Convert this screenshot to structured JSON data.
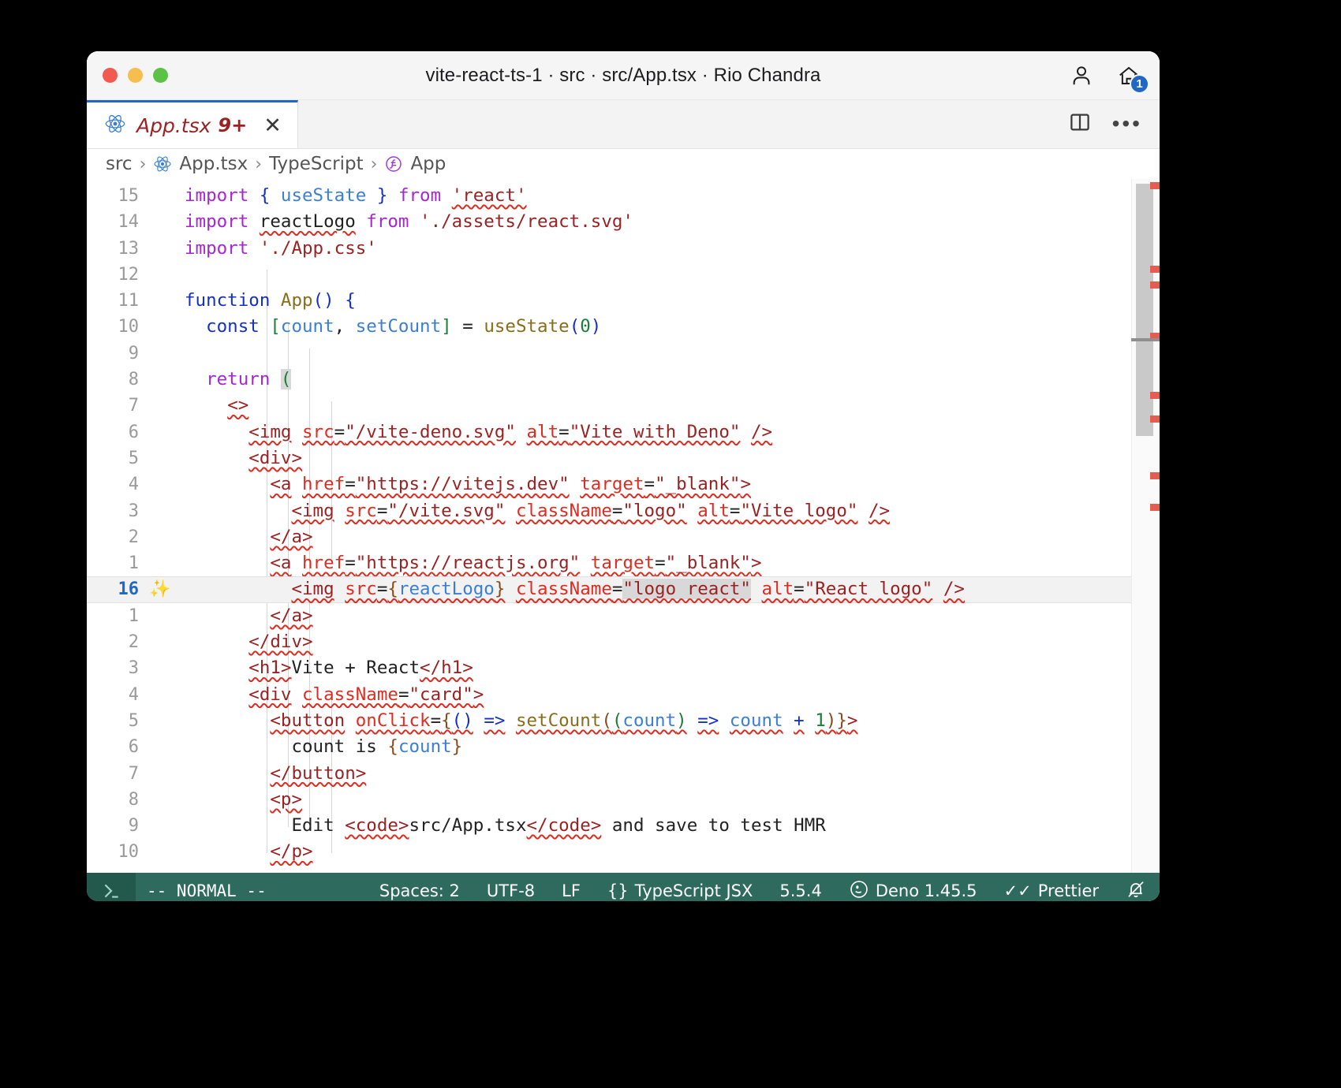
{
  "window": {
    "title": "vite-react-ts-1 · src · src/App.tsx · Rio Chandra",
    "traffic_lights": [
      "close",
      "minimize",
      "zoom"
    ],
    "accent_blue": "#2167c4",
    "home_badge": "1"
  },
  "titlebar_icons": [
    {
      "name": "account-icon",
      "label": "Account"
    },
    {
      "name": "home-icon",
      "label": "Home"
    }
  ],
  "tab": {
    "icon": "react-icon",
    "label": "App.tsx",
    "badge": "9+",
    "close": "✕"
  },
  "tabbar_actions": [
    {
      "name": "split-editor-icon",
      "label": "Split Editor Right"
    },
    {
      "name": "more-actions-icon",
      "label": "•••"
    }
  ],
  "breadcrumb": {
    "items": [
      {
        "label": "src",
        "icon": null
      },
      {
        "label": "App.tsx",
        "icon": "react-icon"
      },
      {
        "label": "TypeScript",
        "icon": null
      },
      {
        "label": "App",
        "icon": "function-symbol-icon"
      }
    ],
    "separator": "›"
  },
  "editor": {
    "current_line": "16",
    "lightbulb": "✨",
    "lines": [
      {
        "num": "15",
        "current": false,
        "tokens": [
          {
            "t": "import",
            "c": "k-import"
          },
          {
            "t": " ",
            "c": "k-plain"
          },
          {
            "t": "{",
            "c": "k-blue"
          },
          {
            "t": " ",
            "c": "k-plain"
          },
          {
            "t": "useState",
            "c": "k-var"
          },
          {
            "t": " ",
            "c": "k-plain"
          },
          {
            "t": "}",
            "c": "k-blue"
          },
          {
            "t": " ",
            "c": "k-plain"
          },
          {
            "t": "from",
            "c": "k-import"
          },
          {
            "t": " ",
            "c": "k-plain"
          },
          {
            "t": "'react'",
            "c": "k-str sq"
          }
        ]
      },
      {
        "num": "14",
        "current": false,
        "tokens": [
          {
            "t": "import",
            "c": "k-import"
          },
          {
            "t": " ",
            "c": "k-plain"
          },
          {
            "t": "reactLogo",
            "c": "k-plain sq"
          },
          {
            "t": " ",
            "c": "k-plain"
          },
          {
            "t": "from",
            "c": "k-import"
          },
          {
            "t": " ",
            "c": "k-plain"
          },
          {
            "t": "'./assets/react.svg'",
            "c": "k-str"
          }
        ]
      },
      {
        "num": "13",
        "current": false,
        "tokens": [
          {
            "t": "import",
            "c": "k-import"
          },
          {
            "t": " ",
            "c": "k-plain"
          },
          {
            "t": "'./App.css'",
            "c": "k-str"
          }
        ]
      },
      {
        "num": "12",
        "current": false,
        "tokens": []
      },
      {
        "num": "11",
        "current": false,
        "tokens": [
          {
            "t": "function",
            "c": "k-blue"
          },
          {
            "t": " ",
            "c": "k-plain"
          },
          {
            "t": "App",
            "c": "k-fn"
          },
          {
            "t": "()",
            "c": "k-blue"
          },
          {
            "t": " ",
            "c": "k-plain"
          },
          {
            "t": "{",
            "c": "k-blue"
          }
        ]
      },
      {
        "num": "10",
        "current": false,
        "tokens": [
          {
            "t": "  ",
            "c": "k-plain"
          },
          {
            "t": "const",
            "c": "k-blue"
          },
          {
            "t": " ",
            "c": "k-plain"
          },
          {
            "t": "[",
            "c": "k-num"
          },
          {
            "t": "count",
            "c": "k-var"
          },
          {
            "t": ", ",
            "c": "k-plain"
          },
          {
            "t": "setCount",
            "c": "k-var"
          },
          {
            "t": "]",
            "c": "k-num"
          },
          {
            "t": " = ",
            "c": "k-plain"
          },
          {
            "t": "useState",
            "c": "k-fn"
          },
          {
            "t": "(",
            "c": "k-blue"
          },
          {
            "t": "0",
            "c": "k-num"
          },
          {
            "t": ")",
            "c": "k-blue"
          }
        ]
      },
      {
        "num": "9",
        "current": false,
        "tokens": []
      },
      {
        "num": "8",
        "current": false,
        "tokens": [
          {
            "t": "  ",
            "c": "k-plain"
          },
          {
            "t": "return",
            "c": "k-import"
          },
          {
            "t": " ",
            "c": "k-plain"
          },
          {
            "t": "(",
            "c": "k-num sel"
          }
        ]
      },
      {
        "num": "7",
        "current": false,
        "tokens": [
          {
            "t": "    ",
            "c": "k-plain"
          },
          {
            "t": "<>",
            "c": "k-tag sq"
          }
        ]
      },
      {
        "num": "6",
        "current": false,
        "tokens": [
          {
            "t": "      ",
            "c": "k-plain"
          },
          {
            "t": "<img",
            "c": "k-tag sq"
          },
          {
            "t": " ",
            "c": "k-plain"
          },
          {
            "t": "src",
            "c": "k-attr sq"
          },
          {
            "t": "=",
            "c": "k-plain sq"
          },
          {
            "t": "\"/vite-deno.svg\"",
            "c": "k-str sq"
          },
          {
            "t": " ",
            "c": "k-plain"
          },
          {
            "t": "alt",
            "c": "k-attr sq"
          },
          {
            "t": "=",
            "c": "k-plain sq"
          },
          {
            "t": "\"Vite with Deno\"",
            "c": "k-str sq"
          },
          {
            "t": " ",
            "c": "k-plain"
          },
          {
            "t": "/>",
            "c": "k-tag sq"
          }
        ]
      },
      {
        "num": "5",
        "current": false,
        "tokens": [
          {
            "t": "      ",
            "c": "k-plain"
          },
          {
            "t": "<div>",
            "c": "k-tag sq"
          }
        ]
      },
      {
        "num": "4",
        "current": false,
        "tokens": [
          {
            "t": "        ",
            "c": "k-plain"
          },
          {
            "t": "<a",
            "c": "k-tag sq"
          },
          {
            "t": " ",
            "c": "k-plain"
          },
          {
            "t": "href",
            "c": "k-attr sq"
          },
          {
            "t": "=",
            "c": "k-plain sq"
          },
          {
            "t": "\"https://vitejs.dev\"",
            "c": "k-str sq"
          },
          {
            "t": " ",
            "c": "k-plain"
          },
          {
            "t": "target",
            "c": "k-attr sq"
          },
          {
            "t": "=",
            "c": "k-plain sq"
          },
          {
            "t": "\"_blank\"",
            "c": "k-str sq"
          },
          {
            "t": ">",
            "c": "k-tag sq"
          }
        ]
      },
      {
        "num": "3",
        "current": false,
        "tokens": [
          {
            "t": "          ",
            "c": "k-plain"
          },
          {
            "t": "<img",
            "c": "k-tag sq"
          },
          {
            "t": " ",
            "c": "k-plain"
          },
          {
            "t": "src",
            "c": "k-attr sq"
          },
          {
            "t": "=",
            "c": "k-plain sq"
          },
          {
            "t": "\"/vite.svg\"",
            "c": "k-str sq"
          },
          {
            "t": " ",
            "c": "k-plain"
          },
          {
            "t": "className",
            "c": "k-attr sq"
          },
          {
            "t": "=",
            "c": "k-plain sq"
          },
          {
            "t": "\"logo\"",
            "c": "k-str sq"
          },
          {
            "t": " ",
            "c": "k-plain"
          },
          {
            "t": "alt",
            "c": "k-attr sq"
          },
          {
            "t": "=",
            "c": "k-plain sq"
          },
          {
            "t": "\"Vite logo\"",
            "c": "k-str sq"
          },
          {
            "t": " ",
            "c": "k-plain"
          },
          {
            "t": "/>",
            "c": "k-tag sq"
          }
        ]
      },
      {
        "num": "2",
        "current": false,
        "tokens": [
          {
            "t": "        ",
            "c": "k-plain"
          },
          {
            "t": "</a>",
            "c": "k-tag sq"
          }
        ]
      },
      {
        "num": "1",
        "current": false,
        "tokens": [
          {
            "t": "        ",
            "c": "k-plain"
          },
          {
            "t": "<a",
            "c": "k-tag sq"
          },
          {
            "t": " ",
            "c": "k-plain"
          },
          {
            "t": "href",
            "c": "k-attr sq"
          },
          {
            "t": "=",
            "c": "k-plain sq"
          },
          {
            "t": "\"https://reactjs.org\"",
            "c": "k-str sq"
          },
          {
            "t": " ",
            "c": "k-plain"
          },
          {
            "t": "target",
            "c": "k-attr sq"
          },
          {
            "t": "=",
            "c": "k-plain sq"
          },
          {
            "t": "\"_blank\"",
            "c": "k-str sq"
          },
          {
            "t": ">",
            "c": "k-tag sq"
          }
        ]
      },
      {
        "num": "16",
        "current": true,
        "tokens": [
          {
            "t": "          ",
            "c": "k-plain"
          },
          {
            "t": "<img",
            "c": "k-tag sq"
          },
          {
            "t": " ",
            "c": "k-plain"
          },
          {
            "t": "src",
            "c": "k-attr sq"
          },
          {
            "t": "=",
            "c": "k-plain sq"
          },
          {
            "t": "{",
            "c": "k-brace sq"
          },
          {
            "t": "reactLogo",
            "c": "k-var sq"
          },
          {
            "t": "}",
            "c": "k-brace sq"
          },
          {
            "t": " ",
            "c": "k-plain"
          },
          {
            "t": "className",
            "c": "k-attr sq"
          },
          {
            "t": "=",
            "c": "k-plain sq"
          },
          {
            "t": "\"logo react\"",
            "c": "k-str sq sel"
          },
          {
            "t": " ",
            "c": "k-plain"
          },
          {
            "t": "alt",
            "c": "k-attr sq"
          },
          {
            "t": "=",
            "c": "k-plain sq"
          },
          {
            "t": "\"React logo\"",
            "c": "k-str sq"
          },
          {
            "t": " ",
            "c": "k-plain"
          },
          {
            "t": "/>",
            "c": "k-tag sq"
          }
        ]
      },
      {
        "num": "1",
        "current": false,
        "tokens": [
          {
            "t": "        ",
            "c": "k-plain"
          },
          {
            "t": "</a>",
            "c": "k-tag sq"
          }
        ]
      },
      {
        "num": "2",
        "current": false,
        "tokens": [
          {
            "t": "      ",
            "c": "k-plain"
          },
          {
            "t": "</div>",
            "c": "k-tag sq"
          }
        ]
      },
      {
        "num": "3",
        "current": false,
        "tokens": [
          {
            "t": "      ",
            "c": "k-plain"
          },
          {
            "t": "<h1>",
            "c": "k-tag sq"
          },
          {
            "t": "Vite + React",
            "c": "k-plain"
          },
          {
            "t": "</h1>",
            "c": "k-tag sq"
          }
        ]
      },
      {
        "num": "4",
        "current": false,
        "tokens": [
          {
            "t": "      ",
            "c": "k-plain"
          },
          {
            "t": "<div",
            "c": "k-tag sq"
          },
          {
            "t": " ",
            "c": "k-plain"
          },
          {
            "t": "className",
            "c": "k-attr sq"
          },
          {
            "t": "=",
            "c": "k-plain sq"
          },
          {
            "t": "\"card\"",
            "c": "k-str sq"
          },
          {
            "t": ">",
            "c": "k-tag sq"
          }
        ]
      },
      {
        "num": "5",
        "current": false,
        "tokens": [
          {
            "t": "        ",
            "c": "k-plain"
          },
          {
            "t": "<button",
            "c": "k-tag sq"
          },
          {
            "t": " ",
            "c": "k-plain"
          },
          {
            "t": "onClick",
            "c": "k-attr sq"
          },
          {
            "t": "=",
            "c": "k-plain sq"
          },
          {
            "t": "{",
            "c": "k-brace sq"
          },
          {
            "t": "()",
            "c": "k-blue sq"
          },
          {
            "t": " ",
            "c": "k-plain"
          },
          {
            "t": "=>",
            "c": "k-blue sq"
          },
          {
            "t": " ",
            "c": "k-plain"
          },
          {
            "t": "setCount",
            "c": "k-fn sq"
          },
          {
            "t": "(",
            "c": "k-brace sq"
          },
          {
            "t": "(",
            "c": "k-num sq"
          },
          {
            "t": "count",
            "c": "k-var sq"
          },
          {
            "t": ")",
            "c": "k-num sq"
          },
          {
            "t": " ",
            "c": "k-plain"
          },
          {
            "t": "=>",
            "c": "k-blue sq"
          },
          {
            "t": " ",
            "c": "k-plain"
          },
          {
            "t": "count",
            "c": "k-var sq"
          },
          {
            "t": " ",
            "c": "k-plain"
          },
          {
            "t": "+",
            "c": "k-blue sq"
          },
          {
            "t": " ",
            "c": "k-plain"
          },
          {
            "t": "1",
            "c": "k-num sq"
          },
          {
            "t": ")",
            "c": "k-brace sq"
          },
          {
            "t": "}",
            "c": "k-brace sq"
          },
          {
            "t": ">",
            "c": "k-tag sq"
          }
        ]
      },
      {
        "num": "6",
        "current": false,
        "tokens": [
          {
            "t": "          ",
            "c": "k-plain"
          },
          {
            "t": "count is ",
            "c": "k-plain"
          },
          {
            "t": "{",
            "c": "k-brace"
          },
          {
            "t": "count",
            "c": "k-var"
          },
          {
            "t": "}",
            "c": "k-brace"
          }
        ]
      },
      {
        "num": "7",
        "current": false,
        "tokens": [
          {
            "t": "        ",
            "c": "k-plain"
          },
          {
            "t": "</button>",
            "c": "k-tag sq"
          }
        ]
      },
      {
        "num": "8",
        "current": false,
        "tokens": [
          {
            "t": "        ",
            "c": "k-plain"
          },
          {
            "t": "<p>",
            "c": "k-tag sq"
          }
        ]
      },
      {
        "num": "9",
        "current": false,
        "tokens": [
          {
            "t": "          ",
            "c": "k-plain"
          },
          {
            "t": "Edit ",
            "c": "k-plain"
          },
          {
            "t": "<code>",
            "c": "k-tag sq"
          },
          {
            "t": "src/App.tsx",
            "c": "k-plain"
          },
          {
            "t": "</code>",
            "c": "k-tag sq"
          },
          {
            "t": " and save to test HMR",
            "c": "k-plain"
          }
        ]
      },
      {
        "num": "10",
        "current": false,
        "tokens": [
          {
            "t": "        ",
            "c": "k-plain"
          },
          {
            "t": "</p>",
            "c": "k-tag sq"
          }
        ]
      }
    ]
  },
  "statusbar": {
    "vim_icon": "vim-logo-icon",
    "mode": "-- NORMAL --",
    "items": [
      {
        "name": "indentation",
        "label": "Spaces: 2"
      },
      {
        "name": "encoding",
        "label": "UTF-8"
      },
      {
        "name": "eol",
        "label": "LF"
      },
      {
        "name": "language-mode",
        "label": "TypeScript JSX",
        "prefix": "{}"
      },
      {
        "name": "typescript-version",
        "label": "5.5.4"
      },
      {
        "name": "deno-version",
        "label": "Deno 1.45.5",
        "icon": "deno-icon"
      },
      {
        "name": "prettier",
        "label": "Prettier",
        "prefix": "✓✓"
      },
      {
        "name": "notifications",
        "label": "",
        "icon": "bell-slash-icon"
      }
    ]
  }
}
